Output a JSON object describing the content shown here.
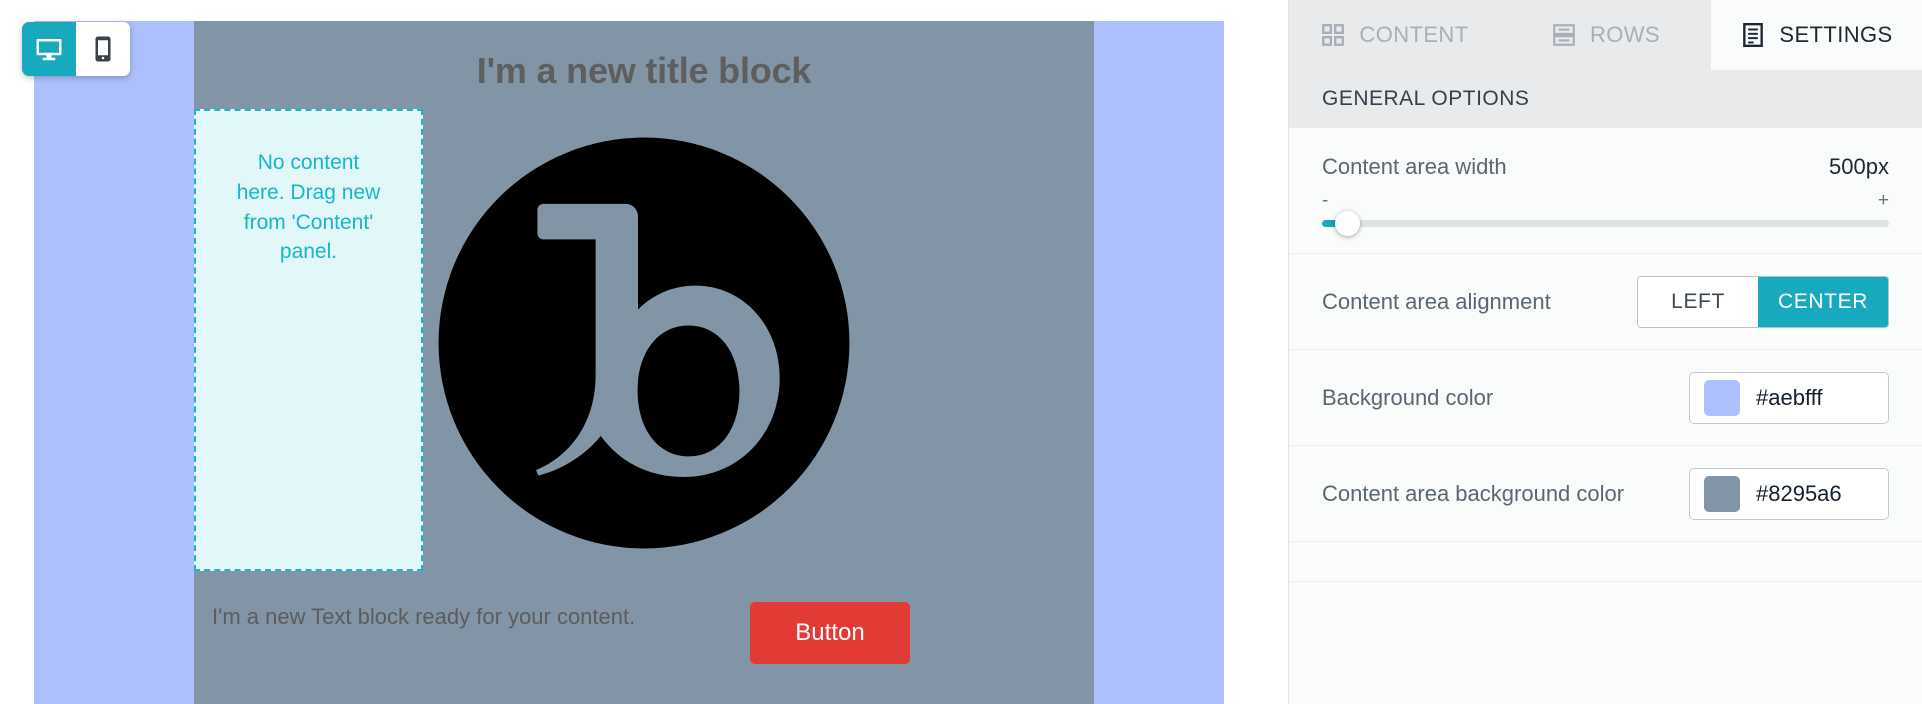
{
  "editor": {
    "devices": [
      {
        "name": "desktop",
        "icon": "desktop-icon",
        "active": true
      },
      {
        "name": "mobile",
        "icon": "mobile-icon",
        "active": false
      }
    ],
    "canvas": {
      "page_background_color": "#aebfff",
      "content_area_background_color": "#8295a6",
      "title_block": "I'm a new title block",
      "drop_zone_text": "No content here. Drag new from 'Content' panel.",
      "drop_zone_border_color": "#17b6c9",
      "drop_zone_fill_color": "#e2f7f8",
      "text_block": "I'm a new Text block ready for your content.",
      "button_label": "Button",
      "button_color": "#e23a35",
      "logo_alt": "b-logo-image"
    }
  },
  "panel": {
    "tabs": [
      {
        "label": "CONTENT",
        "icon": "grid-icon",
        "active": false
      },
      {
        "label": "ROWS",
        "icon": "rows-icon",
        "active": false
      },
      {
        "label": "SETTINGS",
        "icon": "settings-list-icon",
        "active": true
      }
    ],
    "section_title": "GENERAL OPTIONS",
    "options": {
      "content_area_width": {
        "label": "Content area width",
        "value": "500px",
        "minus": "-",
        "plus": "+",
        "slider_percent": 3
      },
      "content_area_alignment": {
        "label": "Content area alignment",
        "choices": [
          {
            "label": "LEFT",
            "active": false
          },
          {
            "label": "CENTER",
            "active": true
          }
        ]
      },
      "background_color": {
        "label": "Background color",
        "value": "#aebfff"
      },
      "content_area_background_color": {
        "label": "Content area background color",
        "value": "#8295a6"
      }
    }
  },
  "accent": "#17a9bd"
}
